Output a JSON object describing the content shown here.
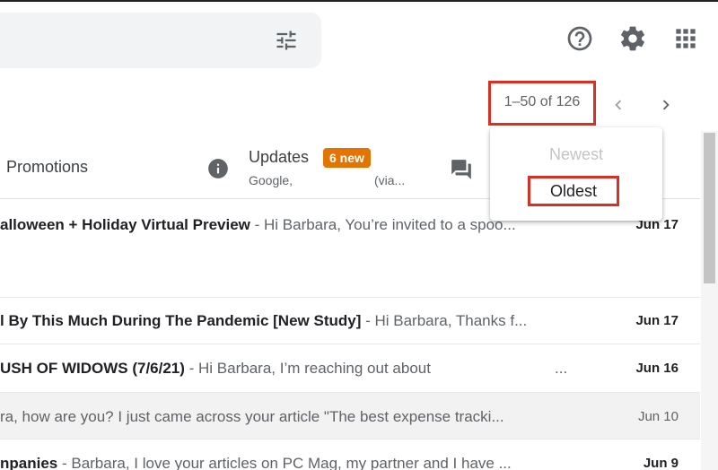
{
  "header": {
    "icons": [
      "tune-icon",
      "help-icon",
      "settings-icon",
      "apps-icon"
    ]
  },
  "toolbar": {
    "range_text": "1–50 of 126",
    "icons": [
      "chevron-left-icon",
      "chevron-right-icon"
    ]
  },
  "tabs": {
    "promotions_label": "Promotions",
    "updates_label": "Updates",
    "updates_badge": "6 new",
    "updates_sub_sender": "Google,",
    "updates_sub_via": "(via...",
    "badge_color": "#e37400",
    "icons": [
      "info-icon",
      "forum-icon"
    ]
  },
  "dropdown": {
    "newest_label": "Newest",
    "oldest_label": "Oldest",
    "highlight_color": "#d93025"
  },
  "emails": [
    {
      "subject": "alloween + Holiday Virtual Preview",
      "snippet": " - Hi Barbara, You’re invited to a spoo...",
      "date": "Jun 17",
      "read": false
    },
    {
      "subject": "l By This Much During The Pandemic [New Study]",
      "snippet": " - Hi Barbara, Thanks f...",
      "date": "Jun 17",
      "read": false
    },
    {
      "subject": "USH OF WIDOWS (7/6/21)",
      "snippet": " - Hi Barbara, I’m reaching out about",
      "trail": "...",
      "date": "Jun 16",
      "read": false
    },
    {
      "subject": "",
      "snippet": "ra, how are you? I just came across your article \"The best expense tracki...",
      "date": "Jun 10",
      "read": true
    },
    {
      "subject": "npanies",
      "snippet": " - Barbara, I love your articles on PC Mag, my partner and I have ...",
      "date": "Jun 9",
      "read": false
    }
  ]
}
